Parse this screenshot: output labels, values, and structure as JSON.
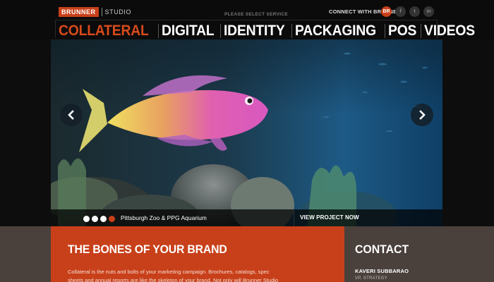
{
  "header": {
    "logo_brand": "BRUNNER",
    "logo_studio": "STUDIO",
    "service_prompt": "PLEASE SELECT SERVICE",
    "connect_label": "CONNECT WITH BRUNNER",
    "social": [
      {
        "label": "BR",
        "icon": "brunner-icon"
      },
      {
        "label": "f",
        "icon": "facebook-icon"
      },
      {
        "label": "t",
        "icon": "twitter-icon"
      },
      {
        "label": "in",
        "icon": "linkedin-icon"
      }
    ]
  },
  "nav": {
    "active": "COLLATERAL",
    "items": [
      "COLLATERAL",
      "DIGITAL",
      "IDENTITY",
      "PACKAGING",
      "POS",
      "VIDEOS"
    ]
  },
  "slideshow": {
    "caption": "Pittsburgh Zoo & PPG Aquarium",
    "view_project": "VIEW PROJECT NOW",
    "dots_total": 4,
    "active_dot": 4
  },
  "section": {
    "title": "THE BONES OF YOUR BRAND",
    "body": "Collateral is the nuts and bolts of your marketing campaign. Brochures, catalogs, spec sheets and annual reports are like the skeleton of your brand. Not only will Brunner Studio"
  },
  "contact": {
    "title": "CONTACT",
    "name": "KAVERI SUBBARAO",
    "role": "VP, STRATEGY"
  },
  "colors": {
    "accent": "#c8401a",
    "nav_active": "#d84a1b",
    "lower_bg": "#4a403c"
  }
}
